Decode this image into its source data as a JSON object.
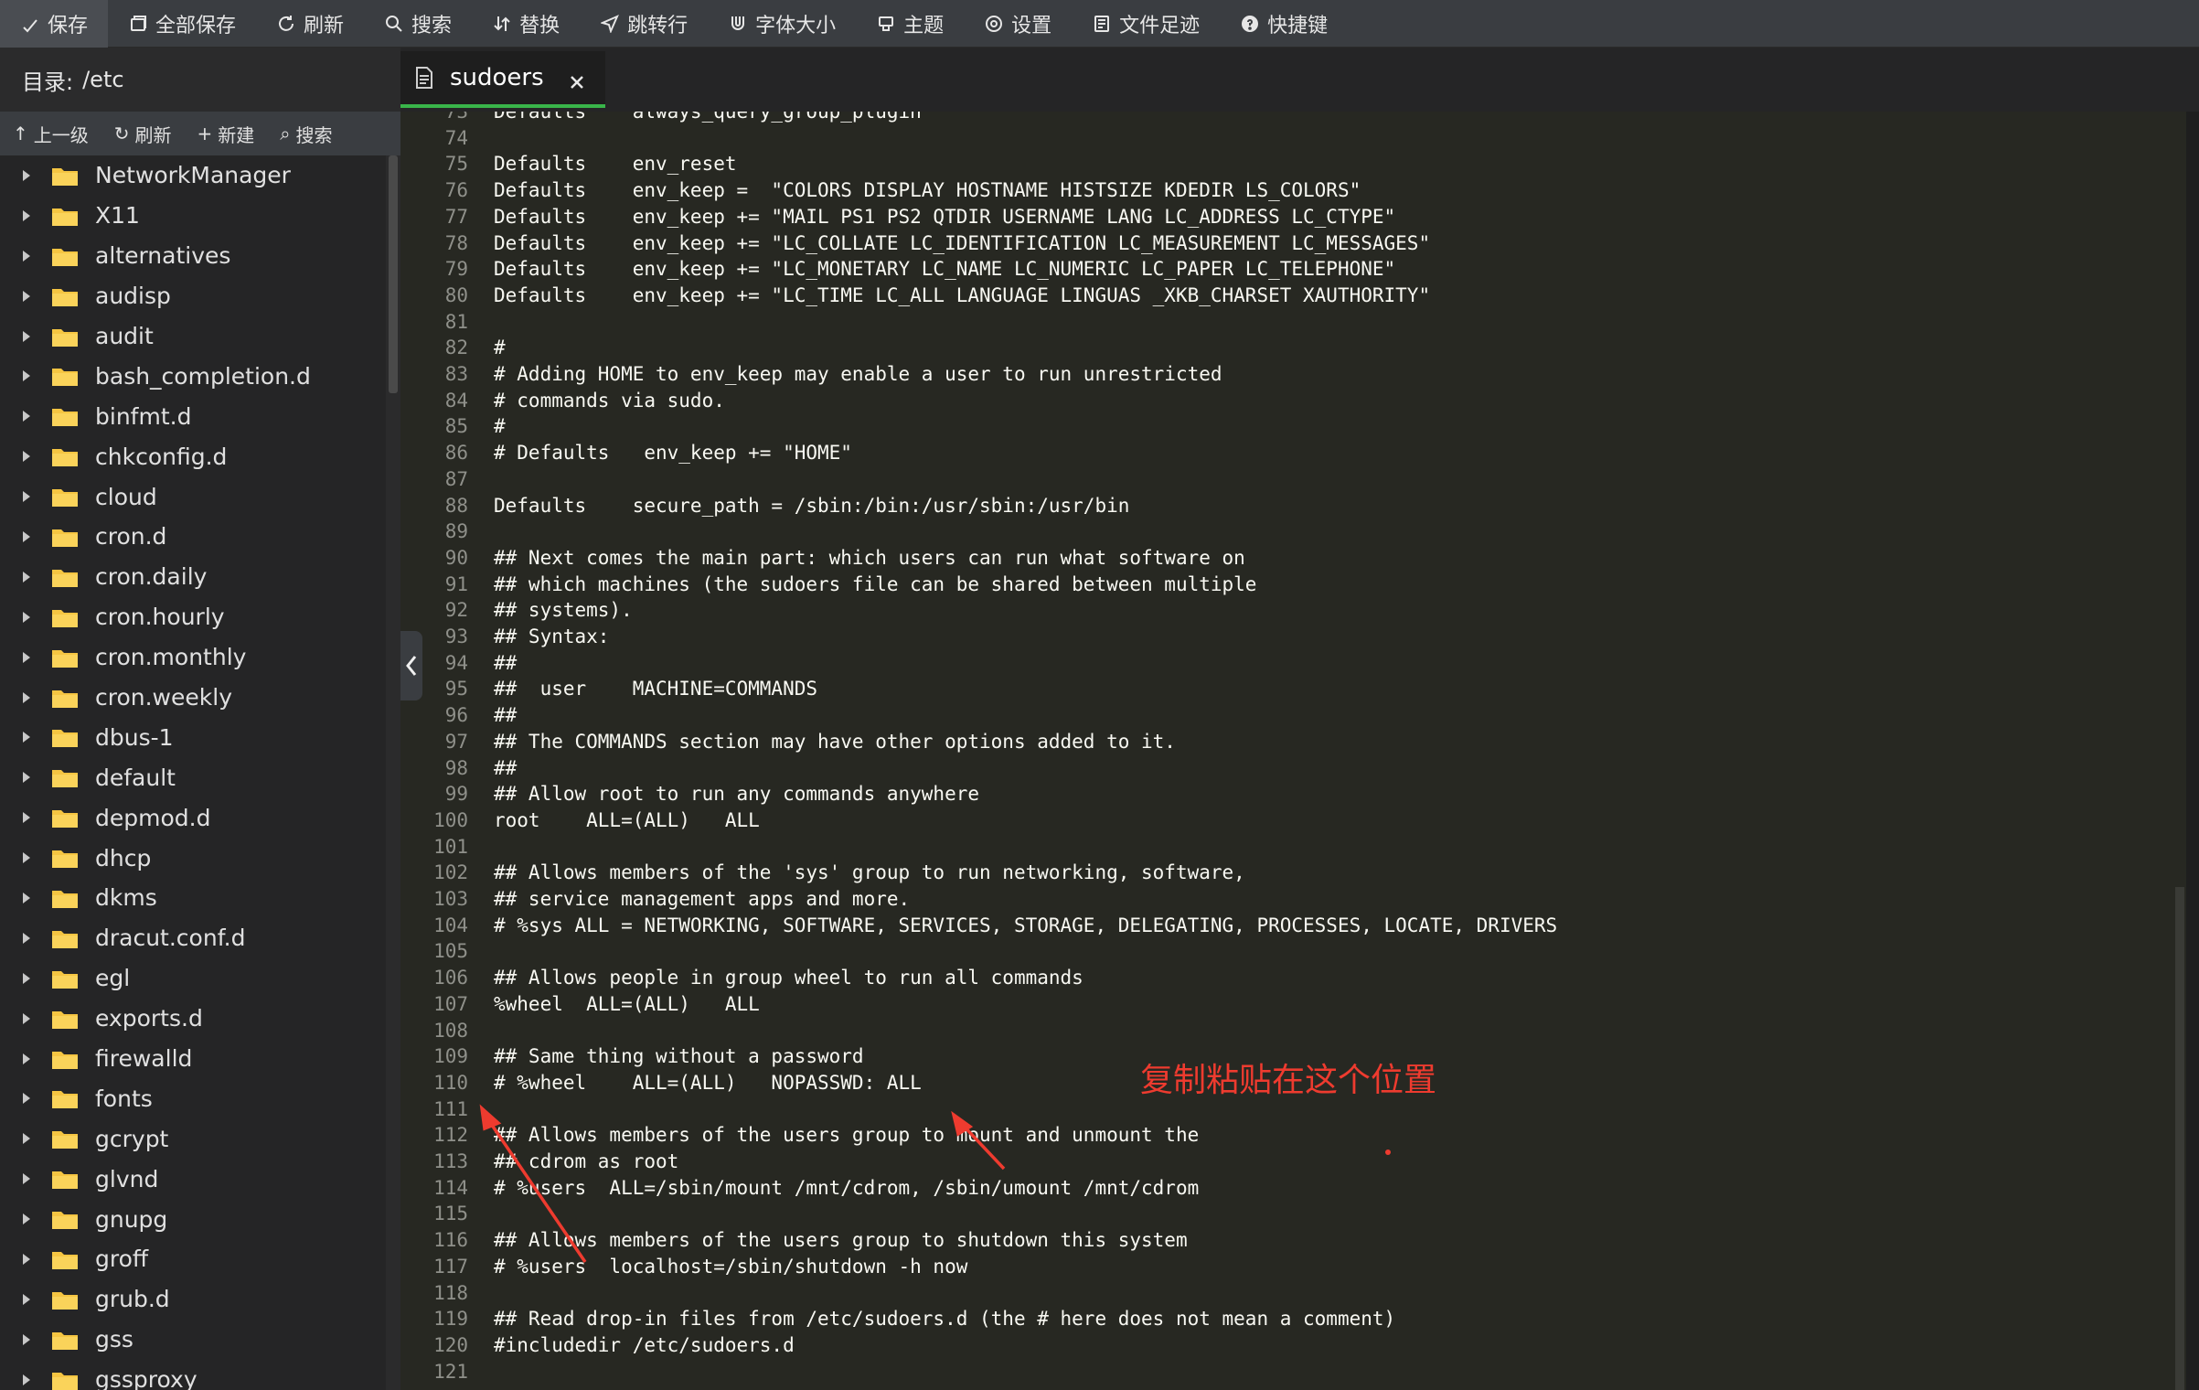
{
  "toolbar": {
    "items": [
      {
        "label": "保存",
        "icon": "save-icon"
      },
      {
        "label": "全部保存",
        "icon": "save-all-icon"
      },
      {
        "label": "刷新",
        "icon": "refresh-icon"
      },
      {
        "label": "搜索",
        "icon": "search-icon"
      },
      {
        "label": "替换",
        "icon": "replace-icon"
      },
      {
        "label": "跳转行",
        "icon": "goto-line-icon"
      },
      {
        "label": "字体大小",
        "icon": "font-size-icon"
      },
      {
        "label": "主题",
        "icon": "theme-icon"
      },
      {
        "label": "设置",
        "icon": "settings-icon"
      },
      {
        "label": "文件足迹",
        "icon": "history-icon"
      },
      {
        "label": "快捷键",
        "icon": "help-icon"
      }
    ]
  },
  "sidebar": {
    "dir_label": "目录:",
    "dir_path": "/etc",
    "actions": [
      {
        "label": "上一级",
        "icon": "arrow-up-icon"
      },
      {
        "label": "刷新",
        "icon": "refresh-icon"
      },
      {
        "label": "新建",
        "icon": "plus-icon"
      },
      {
        "label": "搜索",
        "icon": "search-icon"
      }
    ],
    "tree": [
      "NetworkManager",
      "X11",
      "alternatives",
      "audisp",
      "audit",
      "bash_completion.d",
      "binfmt.d",
      "chkconfig.d",
      "cloud",
      "cron.d",
      "cron.daily",
      "cron.hourly",
      "cron.monthly",
      "cron.weekly",
      "dbus-1",
      "default",
      "depmod.d",
      "dhcp",
      "dkms",
      "dracut.conf.d",
      "egl",
      "exports.d",
      "firewalld",
      "fonts",
      "gcrypt",
      "glvnd",
      "gnupg",
      "groff",
      "grub.d",
      "gss",
      "gssproxy"
    ]
  },
  "tab": {
    "label": "sudoers"
  },
  "editor": {
    "lines": [
      {
        "n": "73",
        "t": "Defaults    always_query_group_plugin"
      },
      {
        "n": "74",
        "t": ""
      },
      {
        "n": "75",
        "t": "Defaults    env_reset"
      },
      {
        "n": "76",
        "t": "Defaults    env_keep =  \"COLORS DISPLAY HOSTNAME HISTSIZE KDEDIR LS_COLORS\""
      },
      {
        "n": "77",
        "t": "Defaults    env_keep += \"MAIL PS1 PS2 QTDIR USERNAME LANG LC_ADDRESS LC_CTYPE\""
      },
      {
        "n": "78",
        "t": "Defaults    env_keep += \"LC_COLLATE LC_IDENTIFICATION LC_MEASUREMENT LC_MESSAGES\""
      },
      {
        "n": "79",
        "t": "Defaults    env_keep += \"LC_MONETARY LC_NAME LC_NUMERIC LC_PAPER LC_TELEPHONE\""
      },
      {
        "n": "80",
        "t": "Defaults    env_keep += \"LC_TIME LC_ALL LANGUAGE LINGUAS _XKB_CHARSET XAUTHORITY\""
      },
      {
        "n": "81",
        "t": ""
      },
      {
        "n": "82",
        "t": "#"
      },
      {
        "n": "83",
        "t": "# Adding HOME to env_keep may enable a user to run unrestricted"
      },
      {
        "n": "84",
        "t": "# commands via sudo."
      },
      {
        "n": "85",
        "t": "#"
      },
      {
        "n": "86",
        "t": "# Defaults   env_keep += \"HOME\""
      },
      {
        "n": "87",
        "t": ""
      },
      {
        "n": "88",
        "t": "Defaults    secure_path = /sbin:/bin:/usr/sbin:/usr/bin"
      },
      {
        "n": "89",
        "t": ""
      },
      {
        "n": "90",
        "t": "## Next comes the main part: which users can run what software on"
      },
      {
        "n": "91",
        "t": "## which machines (the sudoers file can be shared between multiple"
      },
      {
        "n": "92",
        "t": "## systems)."
      },
      {
        "n": "93",
        "t": "## Syntax:"
      },
      {
        "n": "94",
        "t": "##"
      },
      {
        "n": "95",
        "t": "##  user    MACHINE=COMMANDS"
      },
      {
        "n": "96",
        "t": "##"
      },
      {
        "n": "97",
        "t": "## The COMMANDS section may have other options added to it."
      },
      {
        "n": "98",
        "t": "##"
      },
      {
        "n": "99",
        "t": "## Allow root to run any commands anywhere"
      },
      {
        "n": "100",
        "t": "root    ALL=(ALL)   ALL"
      },
      {
        "n": "101",
        "t": ""
      },
      {
        "n": "102",
        "t": "## Allows members of the 'sys' group to run networking, software,"
      },
      {
        "n": "103",
        "t": "## service management apps and more."
      },
      {
        "n": "104",
        "t": "# %sys ALL = NETWORKING, SOFTWARE, SERVICES, STORAGE, DELEGATING, PROCESSES, LOCATE, DRIVERS"
      },
      {
        "n": "105",
        "t": ""
      },
      {
        "n": "106",
        "t": "## Allows people in group wheel to run all commands"
      },
      {
        "n": "107",
        "t": "%wheel  ALL=(ALL)   ALL"
      },
      {
        "n": "108",
        "t": ""
      },
      {
        "n": "109",
        "t": "## Same thing without a password"
      },
      {
        "n": "110",
        "t": "# %wheel    ALL=(ALL)   NOPASSWD: ALL"
      },
      {
        "n": "111",
        "t": ""
      },
      {
        "n": "112",
        "t": "## Allows members of the users group to mount and unmount the"
      },
      {
        "n": "113",
        "t": "## cdrom as root"
      },
      {
        "n": "114",
        "t": "# %users  ALL=/sbin/mount /mnt/cdrom, /sbin/umount /mnt/cdrom"
      },
      {
        "n": "115",
        "t": ""
      },
      {
        "n": "116",
        "t": "## Allows members of the users group to shutdown this system"
      },
      {
        "n": "117",
        "t": "# %users  localhost=/sbin/shutdown -h now"
      },
      {
        "n": "118",
        "t": ""
      },
      {
        "n": "119",
        "t": "## Read drop-in files from /etc/sudoers.d (the # here does not mean a comment)"
      },
      {
        "n": "120",
        "t": "#includedir /etc/sudoers.d"
      },
      {
        "n": "121",
        "t": ""
      }
    ]
  },
  "annotation": {
    "text": "复制粘贴在这个位置",
    "color": "#ee3b2f"
  },
  "colors": {
    "accent": "#39b54a",
    "folder": "#f5c542"
  }
}
